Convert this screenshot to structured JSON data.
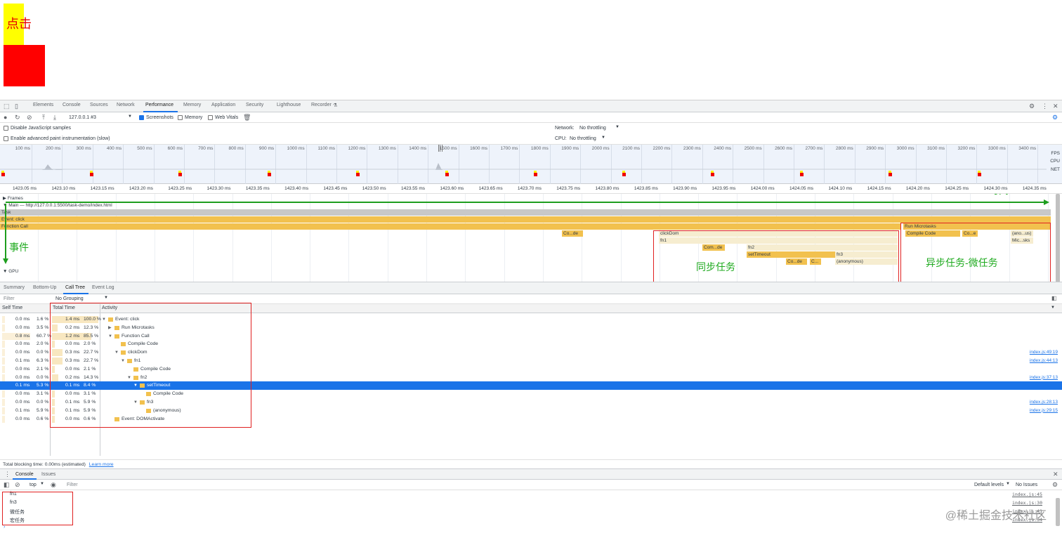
{
  "page": {
    "click_box_text": "点击"
  },
  "devtools": {
    "tabs": [
      "Elements",
      "Console",
      "Sources",
      "Network",
      "Performance",
      "Memory",
      "Application",
      "Security",
      "Lighthouse",
      "Recorder"
    ],
    "active_tab": "Performance",
    "toolbar": {
      "profile_select": "127.0.0.1 #3",
      "screenshots_label": "Screenshots",
      "memory_label": "Memory",
      "web_vitals_label": "Web Vitals"
    },
    "settings": {
      "disable_js_samples": "Disable JavaScript samples",
      "enable_paint": "Enable advanced paint instrumentation (slow)",
      "network_label": "Network:",
      "network_value": "No throttling",
      "cpu_label": "CPU:",
      "cpu_value": "No throttling"
    },
    "overview_ticks": [
      "100 ms",
      "200 ms",
      "300 ms",
      "400 ms",
      "500 ms",
      "600 ms",
      "700 ms",
      "800 ms",
      "900 ms",
      "1000 ms",
      "1100 ms",
      "1200 ms",
      "1300 ms",
      "1400 ms",
      "1500 ms",
      "1600 ms",
      "1700 ms",
      "1800 ms",
      "1900 ms",
      "2000 ms",
      "2100 ms",
      "2200 ms",
      "2300 ms",
      "2400 ms",
      "2500 ms",
      "2600 ms",
      "2700 ms",
      "2800 ms",
      "2900 ms",
      "3000 ms",
      "3100 ms",
      "3200 ms",
      "3300 ms",
      "3400 ms"
    ],
    "overview_labels": {
      "fps": "FPS",
      "cpu": "CPU",
      "net": "NET"
    },
    "ruler_ticks": [
      "1423.05 ms",
      "1423.10 ms",
      "1423.15 ms",
      "1423.20 ms",
      "1423.25 ms",
      "1423.30 ms",
      "1423.35 ms",
      "1423.40 ms",
      "1423.45 ms",
      "1423.50 ms",
      "1423.55 ms",
      "1423.60 ms",
      "1423.65 ms",
      "1423.70 ms",
      "1423.75 ms",
      "1423.80 ms",
      "1423.85 ms",
      "1423.90 ms",
      "1423.95 ms",
      "1424.00 ms",
      "1424.05 ms",
      "1424.10 ms",
      "1424.15 ms",
      "1424.20 ms",
      "1424.25 ms",
      "1424.30 ms",
      "1424.35 ms"
    ],
    "flame": {
      "frames_label": "Frames",
      "main_label": "Main — http://127.0.0.1:5500/task-demo/index.html",
      "task": "Task",
      "event_click": "Event: click",
      "function_call": "Function Call",
      "run_microtasks": "Run Microtasks",
      "compile_code": "Compile Code",
      "co_de": "Co...de",
      "click_dom": "clickDom",
      "fn1": "fn1",
      "com_de": "Com...de",
      "fn2": "fn2",
      "set_timeout": "setTimeout",
      "fn3": "fn3",
      "co_de2": "Co...de",
      "c_dot": "C...",
      "anonymous": "(anonymous)",
      "co_e": "Co...e",
      "ano_us": "(ano...us)",
      "mic_sks": "Mic...sks",
      "gpu_label": "GPU"
    },
    "annotations": {
      "time": "时间",
      "event": "事件",
      "sync": "同步任务",
      "async": "异步任务-微任务"
    },
    "bottom_tabs": [
      "Summary",
      "Bottom-Up",
      "Call Tree",
      "Event Log"
    ],
    "bottom_active": "Call Tree",
    "filter": {
      "placeholder": "Filter",
      "grouping": "No Grouping"
    },
    "tree_headers": {
      "self": "Self Time",
      "total": "Total Time",
      "activity": "Activity"
    },
    "tree_rows": [
      {
        "self": "0.0 ms",
        "self_pct": "1.6 %",
        "total": "1.4 ms",
        "total_pct": "100.0 %",
        "name": "Event: click",
        "level": 0,
        "arrow": "▼",
        "link": "",
        "sfill": 0.016,
        "tfill": 1.0
      },
      {
        "self": "0.0 ms",
        "self_pct": "3.5 %",
        "total": "0.2 ms",
        "total_pct": "12.3 %",
        "name": "Run Microtasks",
        "level": 1,
        "arrow": "▶",
        "link": "",
        "sfill": 0.035,
        "tfill": 0.123
      },
      {
        "self": "0.8 ms",
        "self_pct": "60.7 %",
        "total": "1.2 ms",
        "total_pct": "85.5 %",
        "name": "Function Call",
        "level": 1,
        "arrow": "▼",
        "link": "",
        "sfill": 0.607,
        "tfill": 0.855
      },
      {
        "self": "0.0 ms",
        "self_pct": "2.0 %",
        "total": "0.0 ms",
        "total_pct": "2.0 %",
        "name": "Compile Code",
        "level": 2,
        "arrow": "",
        "link": "",
        "sfill": 0.02,
        "tfill": 0.02
      },
      {
        "self": "0.0 ms",
        "self_pct": "0.0 %",
        "total": "0.3 ms",
        "total_pct": "22.7 %",
        "name": "clickDom",
        "level": 2,
        "arrow": "▼",
        "link": "index.js:49:19",
        "sfill": 0.0,
        "tfill": 0.227
      },
      {
        "self": "0.1 ms",
        "self_pct": "6.3 %",
        "total": "0.3 ms",
        "total_pct": "22.7 %",
        "name": "fn1",
        "level": 3,
        "arrow": "▼",
        "link": "index.js:44:13",
        "sfill": 0.063,
        "tfill": 0.227
      },
      {
        "self": "0.0 ms",
        "self_pct": "2.1 %",
        "total": "0.0 ms",
        "total_pct": "2.1 %",
        "name": "Compile Code",
        "level": 4,
        "arrow": "",
        "link": "",
        "sfill": 0.021,
        "tfill": 0.021
      },
      {
        "self": "0.0 ms",
        "self_pct": "0.0 %",
        "total": "0.2 ms",
        "total_pct": "14.3 %",
        "name": "fn2",
        "level": 4,
        "arrow": "▼",
        "link": "index.js:37:13",
        "sfill": 0.0,
        "tfill": 0.143
      },
      {
        "self": "0.1 ms",
        "self_pct": "5.3 %",
        "total": "0.1 ms",
        "total_pct": "8.4 %",
        "name": "setTimeout",
        "level": 5,
        "arrow": "▼",
        "link": "",
        "sfill": 0.053,
        "tfill": 0.084,
        "selected": true
      },
      {
        "self": "0.0 ms",
        "self_pct": "3.1 %",
        "total": "0.0 ms",
        "total_pct": "3.1 %",
        "name": "Compile Code",
        "level": 6,
        "arrow": "",
        "link": "",
        "sfill": 0.031,
        "tfill": 0.031
      },
      {
        "self": "0.0 ms",
        "self_pct": "0.0 %",
        "total": "0.1 ms",
        "total_pct": "5.9 %",
        "name": "fn3",
        "level": 5,
        "arrow": "▼",
        "link": "index.js:28:13",
        "sfill": 0.0,
        "tfill": 0.059
      },
      {
        "self": "0.1 ms",
        "self_pct": "5.9 %",
        "total": "0.1 ms",
        "total_pct": "5.9 %",
        "name": "(anonymous)",
        "level": 6,
        "arrow": "",
        "link": "index.js:29:15",
        "sfill": 0.059,
        "tfill": 0.059
      },
      {
        "self": "0.0 ms",
        "self_pct": "0.6 %",
        "total": "0.0 ms",
        "total_pct": "0.6 %",
        "name": "Event: DOMActivate",
        "level": 1,
        "arrow": "",
        "link": "",
        "sfill": 0.006,
        "tfill": 0.006
      }
    ],
    "blocking": {
      "text": "Total blocking time: 0.00ms (estimated)",
      "learn_more": "Learn more"
    },
    "console": {
      "tabs": [
        "Console",
        "Issues"
      ],
      "context": "top",
      "filter_placeholder": "Filter",
      "levels": "Default levels",
      "issues": "No Issues",
      "messages": [
        {
          "text": "fn1",
          "src": "index.js:45"
        },
        {
          "text": "fn3",
          "src": "index.js:30"
        },
        {
          "text": "微任务",
          "src": "index.js:41"
        },
        {
          "text": "宏任务",
          "src": "index.js:34"
        }
      ],
      "prompt": "›"
    },
    "watermark": "@稀土掘金技术社区"
  }
}
